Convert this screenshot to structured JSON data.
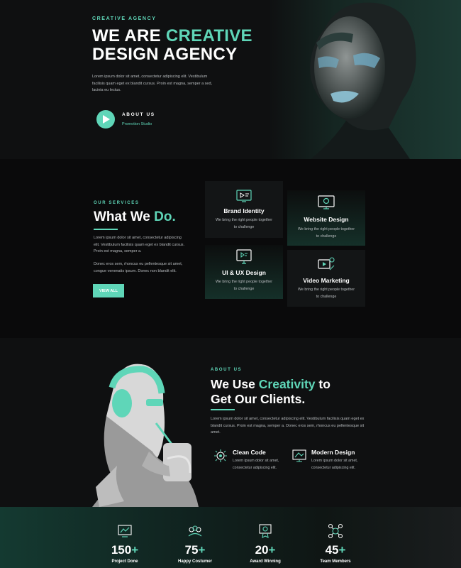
{
  "colors": {
    "accent": "#5fd6b8",
    "background": "#0b0c0d"
  },
  "hero": {
    "kicker": "CREATIVE AGENCY",
    "title_line1_prefix": "WE ARE ",
    "title_line1_accent": "CREATIVE",
    "title_line2": "DESIGN AGENCY",
    "text": "Lorem ipsum dolor sit amet, consectetur adipiscing elit. Vestibulum facilisis quam eget ex blandit cursus. Proin est magna, semper a sed, lacinia eu lectus.",
    "about_link": "ABOUT US",
    "about_sub": "Promotion Studio",
    "play_icon": "play-icon"
  },
  "services": {
    "kicker": "OUR SERVICES",
    "title_prefix": "What We ",
    "title_accent": "Do.",
    "para1": "Lorem ipsum dolor sit amet, consectetur adipiscing elit. Vestibulum facilisis quam eget ex blandit cursus. Proin est magna, semper a.",
    "para2": "Donec eros sem, rhoncus eu pellentesque sit amet, congue venenatis ipsum. Donec non blandit elit.",
    "button": "VIEW ALL",
    "cards": [
      {
        "title": "Brand Identity",
        "desc": "We bring the right people together to challenge",
        "icon": "brand-identity-icon"
      },
      {
        "title": "Website Design",
        "desc": "We bring the right people together to challenge",
        "icon": "website-design-icon"
      },
      {
        "title": "UI & UX Design",
        "desc": "We bring the right people together to challenge",
        "icon": "ui-ux-design-icon"
      },
      {
        "title": "Video Marketing",
        "desc": "We bring the right people together to challenge",
        "icon": "video-marketing-icon"
      }
    ]
  },
  "about": {
    "kicker": "ABOUT US",
    "title_prefix": "We Use ",
    "title_accent": "Creativity",
    "title_suffix": " to",
    "title_line2": "Get Our Clients.",
    "text": "Lorem ipsum dolor sit amet, consectetur adipiscing elit. Vestibulum facilisis quam eget ex blandit cursus. Proin est magna, semper a. Donec eros sem, rhoncus eu pellentesque sit amet.",
    "features": [
      {
        "title": "Clean Code",
        "desc": "Lorem ipsum dolor sit amet, consectetur adipiscing elit.",
        "icon": "clean-code-icon"
      },
      {
        "title": "Modern Design",
        "desc": "Lorem ipsum dolor sit amet, consectetur adipiscing elit.",
        "icon": "modern-design-icon"
      }
    ]
  },
  "stats": [
    {
      "value": "150",
      "suffix": "+",
      "label": "Project Done",
      "icon": "project-icon"
    },
    {
      "value": "75",
      "suffix": "+",
      "label": "Happy Costumer",
      "icon": "customer-icon"
    },
    {
      "value": "20",
      "suffix": "+",
      "label": "Award Winning",
      "icon": "award-icon"
    },
    {
      "value": "45",
      "suffix": "+",
      "label": "Team Members",
      "icon": "team-icon"
    }
  ]
}
